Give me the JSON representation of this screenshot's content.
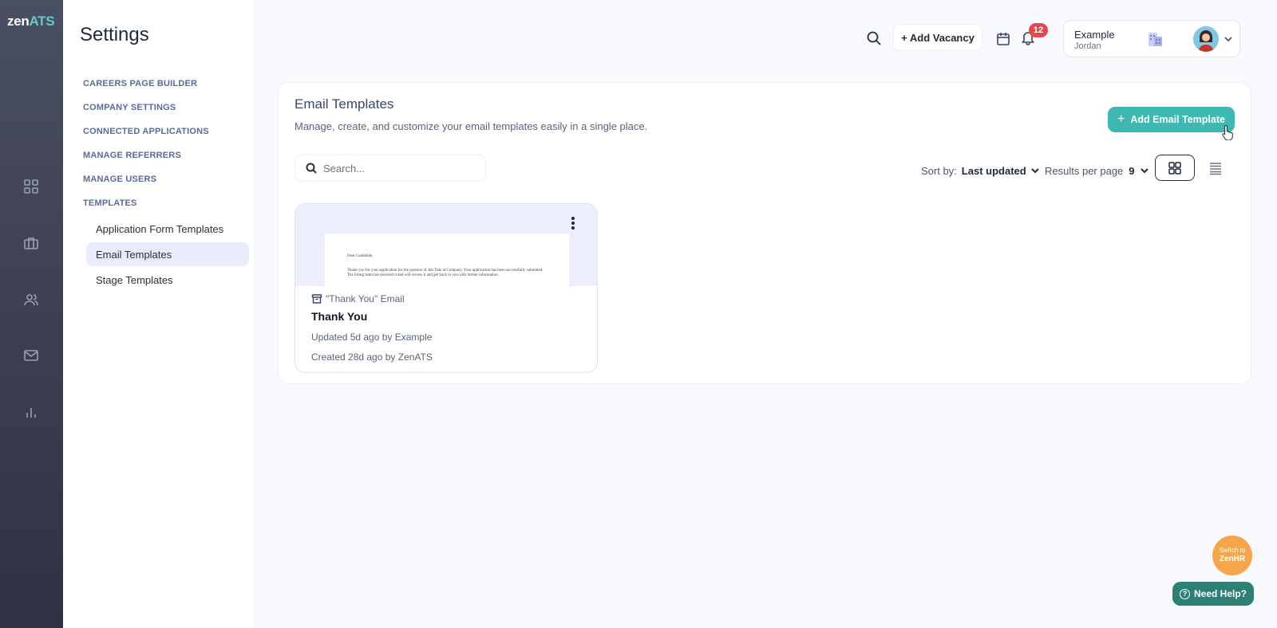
{
  "brand": {
    "logo_zen": "zen",
    "logo_ats": "ATS"
  },
  "sidebar": {
    "title": "Settings",
    "sections": [
      {
        "label": "CAREERS PAGE BUILDER"
      },
      {
        "label": "COMPANY SETTINGS"
      },
      {
        "label": "CONNECTED APPLICATIONS"
      },
      {
        "label": "MANAGE REFERRERS"
      },
      {
        "label": "MANAGE USERS"
      },
      {
        "label": "TEMPLATES"
      }
    ],
    "sub_items": [
      {
        "label": "Application Form Templates",
        "active": false
      },
      {
        "label": "Email Templates",
        "active": true
      },
      {
        "label": "Stage Templates",
        "active": false
      }
    ]
  },
  "rail": {
    "icons": [
      "dashboard-icon",
      "briefcase-icon",
      "users-icon",
      "mail-icon",
      "analytics-icon"
    ]
  },
  "topbar": {
    "add_vacancy_label": "+ Add Vacancy",
    "notification_count": "12",
    "account_name": "Example",
    "account_user": "Jordan"
  },
  "main": {
    "title": "Email Templates",
    "description": "Manage, create, and customize your email templates easily in a single place.",
    "add_button_label": "Add Email Template",
    "search_placeholder": "Search...",
    "sort_label": "Sort by:",
    "sort_value": "Last updated",
    "rpp_label": "Results per page",
    "rpp_value": "9",
    "view_mode": "grid"
  },
  "templates": [
    {
      "category": "\"Thank You\" Email",
      "name": "Thank You",
      "updated": "Updated 5d ago by Example",
      "created": "Created 28d ago by ZenATS",
      "preview_greeting": "Dear Candidate,",
      "preview_body": "Thank you for your application for the position of Job Title at Company. Your application has been successfully submitted. The hiring team has received it and will review it and get back to you with further information."
    }
  ],
  "floating": {
    "switch_line1": "Switch to",
    "switch_line2": "ZenHR",
    "help_label": "Need Help?"
  },
  "colors": {
    "accent": "#3fb8b2",
    "badge": "#e5484d",
    "help": "#2e7f74",
    "switch": "#f5a64a"
  }
}
